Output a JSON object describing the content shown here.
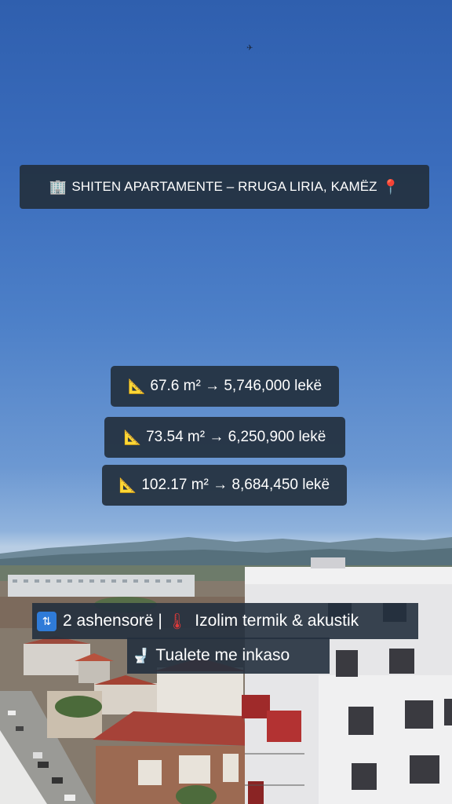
{
  "headline": {
    "icon_left": "office-building-icon",
    "text": "SHITEN APARTAMENTE – RRUGA LIRIA, KAMËZ",
    "icon_right": "round-pushpin-icon"
  },
  "prices": [
    {
      "icon": "triangular-ruler-icon",
      "text": "67.6 m² → 5,746,000 lekë"
    },
    {
      "icon": "triangular-ruler-icon",
      "text": "73.54 m² → 6,250,900 lekë"
    },
    {
      "icon": "triangular-ruler-icon",
      "text": "102.17 m² → 8,684,450 lekë"
    }
  ],
  "features": {
    "elevators": {
      "icon": "elevator-icon",
      "text": "2 ashensorë |"
    },
    "insulation": {
      "icon": "thermometer-icon",
      "text": "Izolim termik & akustik"
    },
    "toilets": {
      "icon": "toilet-icon",
      "text": "Tualete me inkaso"
    }
  },
  "colors": {
    "sky_top": "#2f5fae",
    "overlay": "#23303e"
  }
}
